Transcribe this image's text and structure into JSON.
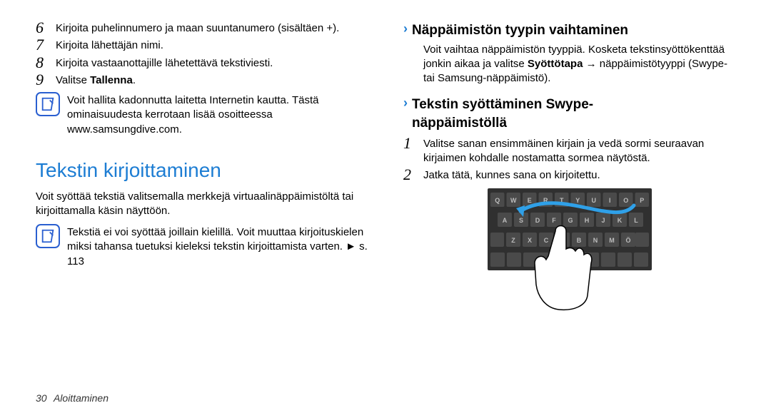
{
  "left": {
    "step6": "Kirjoita puhelinnumero ja maan suuntanumero (sisältäen +).",
    "step7": "Kirjoita lähettäjän nimi.",
    "step8": "Kirjoita vastaanottajille lähetettävä tekstiviesti.",
    "step9_pre": "Valitse ",
    "step9_bold": "Tallenna",
    "step9_post": ".",
    "note1": "Voit hallita kadonnutta laitetta Internetin kautta. Tästä ominaisuudesta kerrotaan lisää osoitteessa www.samsungdive.com.",
    "heading1": "Tekstin kirjoittaminen",
    "para1": "Voit syöttää tekstiä valitsemalla merkkejä virtuaalinäppäimistöltä tai kirjoittamalla käsin näyttöön.",
    "note2": "Tekstiä ei voi syöttää joillain kielillä. Voit muuttaa kirjoituskielen miksi tahansa tuetuksi kieleksi tekstin kirjoittamista varten. ► s. 113"
  },
  "right": {
    "sub1": "Näppäimistön tyypin vaihtaminen",
    "sub1para_pre": "Voit vaihtaa näppäimistön tyyppiä. Kosketa tekstinsyöttökenttää jonkin aikaa ja valitse ",
    "sub1para_bold": "Syöttötapa",
    "sub1para_post": " → näppäimistötyyppi (Swype- tai Samsung-näppäimistö).",
    "sub2_line1": "Tekstin syöttäminen Swype-",
    "sub2_line2": "näppäimistöllä",
    "step1": "Valitse sanan ensimmäinen kirjain ja vedä sormi seuraavan kirjaimen kohdalle nostamatta sormea näytöstä.",
    "step2": "Jatka tätä, kunnes sana on kirjoitettu.",
    "keys_row1": [
      "Q",
      "W",
      "E",
      "R",
      "T",
      "Y",
      "U",
      "I",
      "O",
      "P"
    ],
    "keys_row2": [
      "A",
      "S",
      "D",
      "F",
      "G",
      "H",
      "J",
      "K",
      "L"
    ],
    "keys_row3": [
      "Z",
      "X",
      "C",
      "V",
      "B",
      "N",
      "M",
      "Ö"
    ]
  },
  "footer": {
    "page": "30",
    "section": "Aloittaminen"
  }
}
